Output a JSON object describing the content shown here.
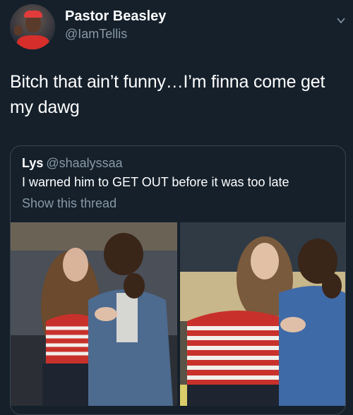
{
  "tweet": {
    "author_name": "Pastor Beasley",
    "author_handle": "@IamTellis",
    "text": "Bitch that ain’t funny…I’m finna come get my dawg"
  },
  "quoted_tweet": {
    "author_name": "Lys",
    "author_handle": "@shaalyssaa",
    "text": "I warned him to GET OUT before it was too late",
    "show_thread_label": "Show this thread"
  },
  "colors": {
    "background": "#15202b",
    "secondary_text": "#8899a6",
    "border": "#38444d"
  },
  "icons": {
    "menu": "chevron-down-icon"
  }
}
